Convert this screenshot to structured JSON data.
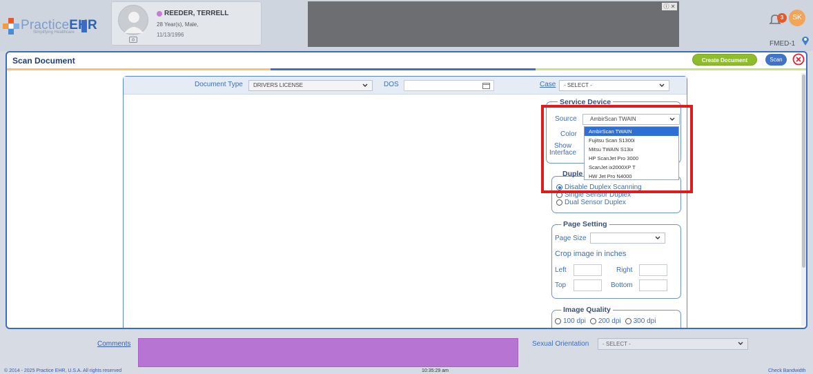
{
  "app": {
    "logo_text_a": "Practice",
    "logo_text_b": "EHR",
    "logo_tagline": "Simplifying Healthcare",
    "notification_count": "3",
    "user_initials": "SK",
    "facility": "FMED-1"
  },
  "patient": {
    "name": "REEDER, TERRELL",
    "age_sex": "28 Year(s), Male,",
    "dob": "11/13/1996"
  },
  "modal": {
    "title": "Scan Document",
    "create_label": "Create Document",
    "scan_label": "Scan"
  },
  "form": {
    "doc_type_label": "Document Type",
    "doc_type_value": "DRIVERS LICENSE",
    "dos_label": "DOS",
    "case_label": "Case",
    "case_value": "- SELECT -"
  },
  "device": {
    "legend": "Service Device",
    "source_label": "Source",
    "source_value": "AmbirScan TWAIN",
    "source_options": [
      "AmbirScan TWAIN",
      "Fujitsu Scan S1300i",
      "Mitsu TWAIN S13ix",
      "HP ScanJet Pro 3000",
      "ScanJet ix2000XP T",
      "HW Jet Pro N4000"
    ],
    "color_label": "Color",
    "show_label": "Show",
    "interface_label": "Interface"
  },
  "duplex": {
    "legend_visible": "Duple",
    "options": [
      "Disable Duplex Scanning",
      "Single Sensor Duplex",
      "Dual Sensor Duplex"
    ],
    "selected": 0
  },
  "page_setting": {
    "legend": "Page Setting",
    "page_size_label": "Page Size",
    "crop_label": "Crop image in inches",
    "left_label": "Left",
    "right_label": "Right",
    "top_label": "Top",
    "bottom_label": "Bottom"
  },
  "quality": {
    "legend": "Image Quality",
    "options": [
      "100 dpi",
      "200 dpi",
      "300 dpi"
    ]
  },
  "background": {
    "comments_label": "Comments",
    "orientation_label": "Sexual Orientation",
    "orientation_value": "- SELECT -",
    "copyright": "© 2014 - 2025 Practice EHR, U.S.A. All rights reserved",
    "time": "10:35:29 am",
    "bandwidth": "Check Bandwidth"
  }
}
